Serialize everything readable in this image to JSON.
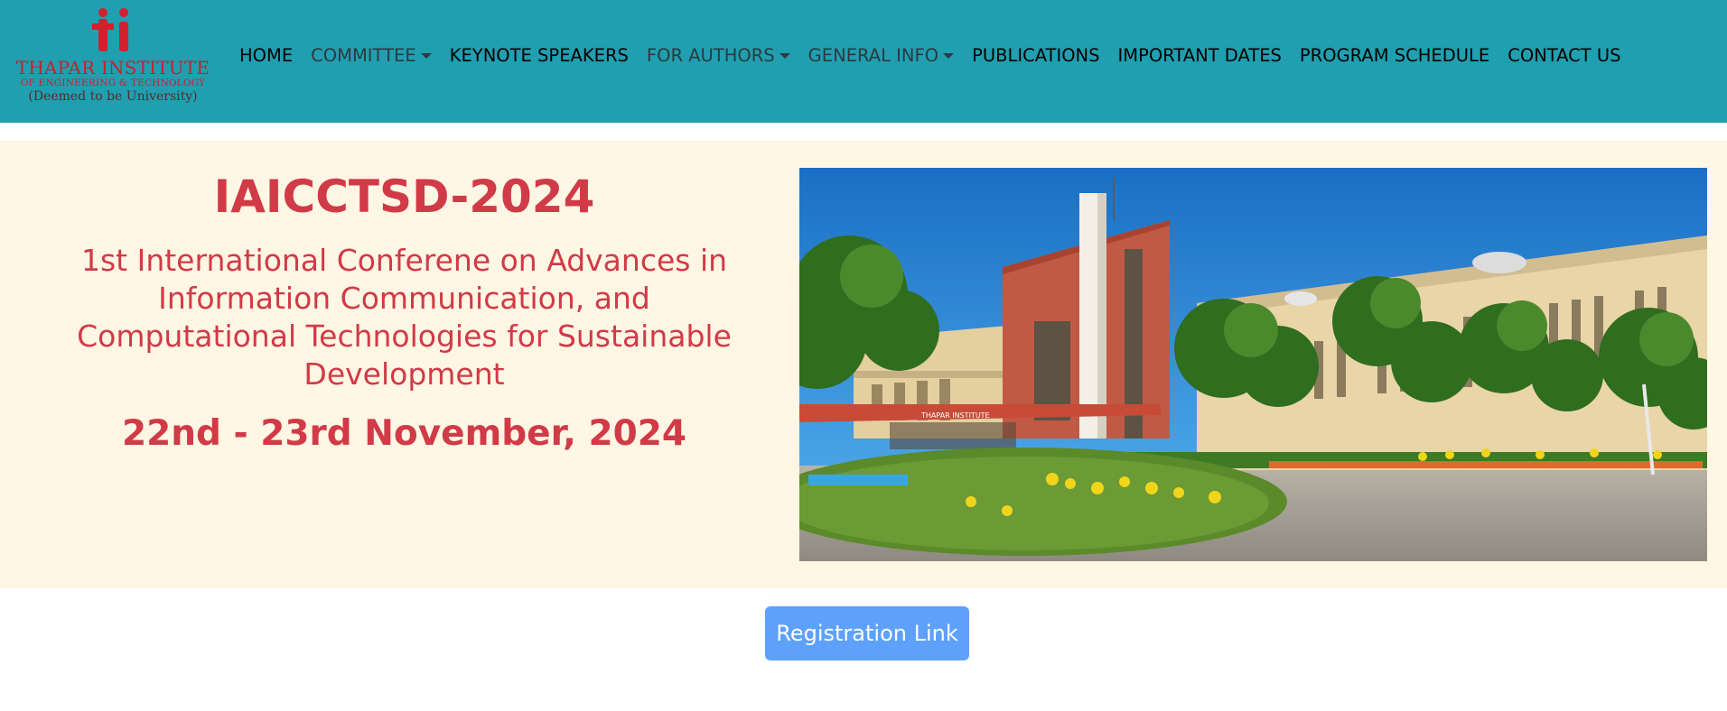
{
  "logo": {
    "mark": "ti",
    "name": "THAPAR INSTITUTE",
    "subtitle": "OF ENGINEERING & TECHNOLOGY",
    "deemed": "(Deemed to be University)"
  },
  "nav": {
    "items": [
      {
        "label": "HOME",
        "dropdown": false
      },
      {
        "label": "COMMITTEE",
        "dropdown": true
      },
      {
        "label": "KEYNOTE SPEAKERS",
        "dropdown": false
      },
      {
        "label": "FOR AUTHORS",
        "dropdown": true
      },
      {
        "label": "GENERAL INFO",
        "dropdown": true
      },
      {
        "label": "PUBLICATIONS",
        "dropdown": false
      },
      {
        "label": "IMPORTANT DATES",
        "dropdown": false
      },
      {
        "label": "PROGRAM SCHEDULE",
        "dropdown": false
      },
      {
        "label": "CONTACT US",
        "dropdown": false
      }
    ]
  },
  "hero": {
    "title": "IAICCTSD-2024",
    "full_name": "1st International Conferene on Advances in Information Communication, and Computational Technologies for Sustainable Development",
    "dates": "22nd - 23rd November, 2024",
    "photo_sign": "THAPAR INSTITUTE"
  },
  "registration": {
    "label": "Registration Link"
  },
  "colors": {
    "navbar": "#1f9fb0",
    "hero_bg": "#fff6e4",
    "accent_red": "#d13a47",
    "button": "#5ea1fb"
  }
}
